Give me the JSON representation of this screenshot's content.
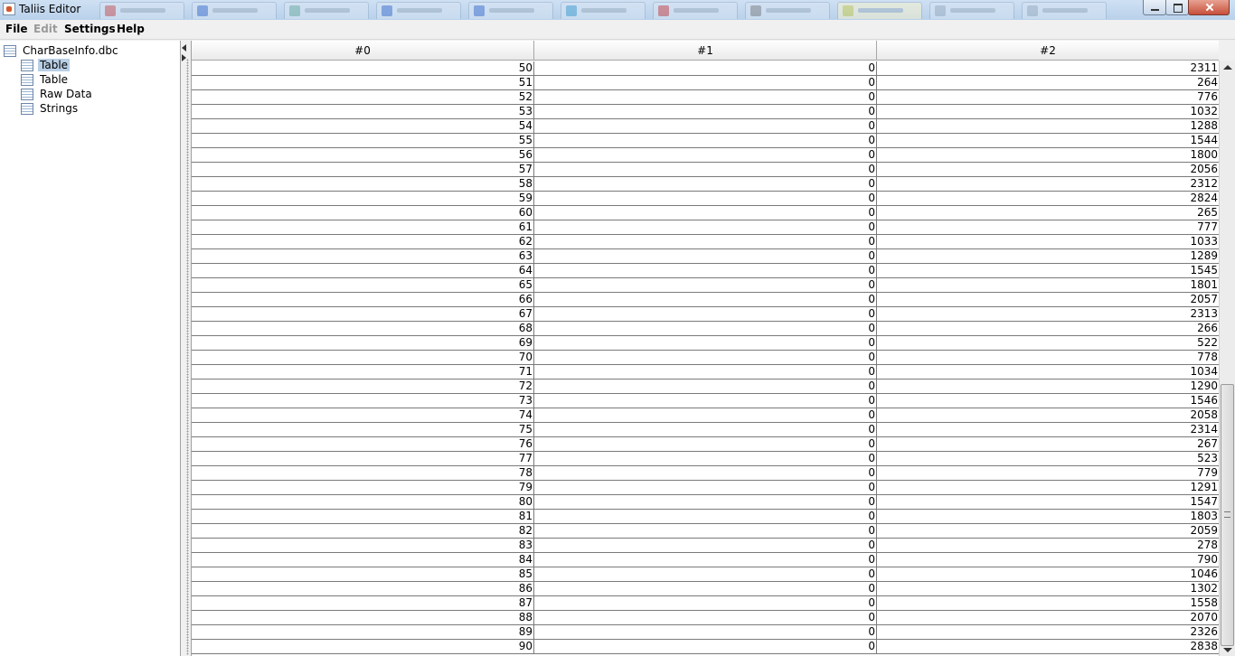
{
  "window": {
    "title": "Taliis Editor"
  },
  "menu": {
    "file": "File",
    "edit": "Edit",
    "settings": "Settings",
    "help": "Help"
  },
  "tree": {
    "root": "CharBaseInfo.dbc",
    "children": [
      "Table",
      "Table",
      "Raw Data",
      "Strings"
    ],
    "selected_index": 0
  },
  "table": {
    "columns": [
      "#0",
      "#1",
      "#2"
    ],
    "rows": [
      [
        "50",
        "0",
        "2311"
      ],
      [
        "51",
        "0",
        "264"
      ],
      [
        "52",
        "0",
        "776"
      ],
      [
        "53",
        "0",
        "1032"
      ],
      [
        "54",
        "0",
        "1288"
      ],
      [
        "55",
        "0",
        "1544"
      ],
      [
        "56",
        "0",
        "1800"
      ],
      [
        "57",
        "0",
        "2056"
      ],
      [
        "58",
        "0",
        "2312"
      ],
      [
        "59",
        "0",
        "2824"
      ],
      [
        "60",
        "0",
        "265"
      ],
      [
        "61",
        "0",
        "777"
      ],
      [
        "62",
        "0",
        "1033"
      ],
      [
        "63",
        "0",
        "1289"
      ],
      [
        "64",
        "0",
        "1545"
      ],
      [
        "65",
        "0",
        "1801"
      ],
      [
        "66",
        "0",
        "2057"
      ],
      [
        "67",
        "0",
        "2313"
      ],
      [
        "68",
        "0",
        "266"
      ],
      [
        "69",
        "0",
        "522"
      ],
      [
        "70",
        "0",
        "778"
      ],
      [
        "71",
        "0",
        "1034"
      ],
      [
        "72",
        "0",
        "1290"
      ],
      [
        "73",
        "0",
        "1546"
      ],
      [
        "74",
        "0",
        "2058"
      ],
      [
        "75",
        "0",
        "2314"
      ],
      [
        "76",
        "0",
        "267"
      ],
      [
        "77",
        "0",
        "523"
      ],
      [
        "78",
        "0",
        "779"
      ],
      [
        "79",
        "0",
        "1291"
      ],
      [
        "80",
        "0",
        "1547"
      ],
      [
        "81",
        "0",
        "1803"
      ],
      [
        "82",
        "0",
        "2059"
      ],
      [
        "83",
        "0",
        "278"
      ],
      [
        "84",
        "0",
        "790"
      ],
      [
        "85",
        "0",
        "1046"
      ],
      [
        "86",
        "0",
        "1302"
      ],
      [
        "87",
        "0",
        "1558"
      ],
      [
        "88",
        "0",
        "2070"
      ],
      [
        "89",
        "0",
        "2326"
      ],
      [
        "90",
        "0",
        "2838"
      ]
    ]
  },
  "icons": {
    "app": "java-app-icon",
    "tree_root": "database-icon",
    "tree_child": "table-icon"
  },
  "colors": {
    "selection": "#b8cfe5",
    "titlebar": "#b9d1ea"
  }
}
